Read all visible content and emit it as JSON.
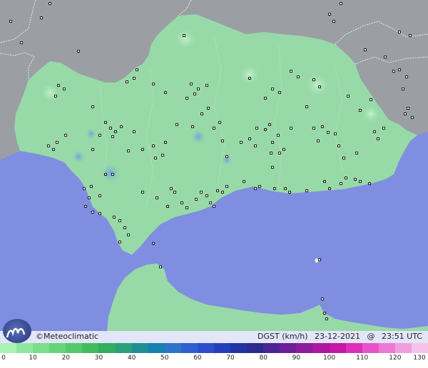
{
  "brand": {
    "logo": "Meteoclimatic logo",
    "text": "©Meteoclimatic"
  },
  "info": {
    "variable": "DGST (km/h)",
    "date": "23-12-2021",
    "at": "@",
    "time": "23:51 UTC"
  },
  "legend": {
    "ticks": [
      "0",
      "10",
      "20",
      "30",
      "40",
      "50",
      "60",
      "70",
      "80",
      "90",
      "100",
      "110",
      "120",
      "130"
    ],
    "colors": [
      "#a9f2b4",
      "#8fe79f",
      "#7ade8a",
      "#66d57a",
      "#53c96b",
      "#41bb5e",
      "#32ad61",
      "#2aa07a",
      "#1f8f95",
      "#1781b0",
      "#2f74c7",
      "#2f5fd0",
      "#2b4dcc",
      "#253fba",
      "#2234a4",
      "#2a2a90",
      "#4b2493",
      "#6c1f97",
      "#8d1b9b",
      "#ad179f",
      "#c816a6",
      "#db2fb8",
      "#e653c8",
      "#ec78d5",
      "#f19ee0",
      "#f6c2ea"
    ]
  },
  "stations": [
    [
      15,
      30
    ],
    [
      70,
      5
    ],
    [
      58,
      25
    ],
    [
      30,
      60
    ],
    [
      110,
      72
    ],
    [
      192,
      98
    ],
    [
      188,
      110
    ],
    [
      178,
      115
    ],
    [
      215,
      118
    ],
    [
      232,
      130
    ],
    [
      268,
      118
    ],
    [
      278,
      125
    ],
    [
      290,
      120
    ],
    [
      273,
      132
    ],
    [
      262,
      138
    ],
    [
      258,
      50
    ],
    [
      350,
      110
    ],
    [
      372,
      138
    ],
    [
      382,
      125
    ],
    [
      392,
      130
    ],
    [
      408,
      100
    ],
    [
      418,
      108
    ],
    [
      440,
      112
    ],
    [
      448,
      122
    ],
    [
      488,
      135
    ],
    [
      505,
      155
    ],
    [
      520,
      140
    ],
    [
      552,
      100
    ],
    [
      560,
      98
    ],
    [
      570,
      108
    ],
    [
      565,
      125
    ],
    [
      572,
      152
    ],
    [
      568,
      160
    ],
    [
      578,
      165
    ],
    [
      512,
      70
    ],
    [
      540,
      80
    ],
    [
      575,
      50
    ],
    [
      560,
      45
    ],
    [
      468,
      30
    ],
    [
      462,
      20
    ],
    [
      478,
      5
    ],
    [
      82,
      120
    ],
    [
      90,
      125
    ],
    [
      78,
      135
    ],
    [
      130,
      150
    ],
    [
      148,
      172
    ],
    [
      155,
      180
    ],
    [
      162,
      185
    ],
    [
      140,
      190
    ],
    [
      158,
      192
    ],
    [
      170,
      178
    ],
    [
      188,
      185
    ],
    [
      130,
      210
    ],
    [
      92,
      190
    ],
    [
      80,
      200
    ],
    [
      75,
      210
    ],
    [
      68,
      205
    ],
    [
      180,
      212
    ],
    [
      200,
      210
    ],
    [
      215,
      205
    ],
    [
      218,
      222
    ],
    [
      228,
      218
    ],
    [
      232,
      200
    ],
    [
      248,
      175
    ],
    [
      270,
      178
    ],
    [
      283,
      160
    ],
    [
      292,
      152
    ],
    [
      300,
      180
    ],
    [
      308,
      172
    ],
    [
      312,
      198
    ],
    [
      318,
      220
    ],
    [
      338,
      200
    ],
    [
      350,
      195
    ],
    [
      358,
      205
    ],
    [
      360,
      180
    ],
    [
      372,
      182
    ],
    [
      378,
      175
    ],
    [
      382,
      200
    ],
    [
      390,
      190
    ],
    [
      398,
      210
    ],
    [
      380,
      215
    ],
    [
      392,
      215
    ],
    [
      382,
      235
    ],
    [
      408,
      180
    ],
    [
      430,
      150
    ],
    [
      440,
      180
    ],
    [
      446,
      198
    ],
    [
      452,
      178
    ],
    [
      460,
      186
    ],
    [
      470,
      188
    ],
    [
      475,
      205
    ],
    [
      482,
      222
    ],
    [
      500,
      215
    ],
    [
      525,
      185
    ],
    [
      530,
      195
    ],
    [
      538,
      180
    ],
    [
      455,
      255
    ],
    [
      462,
      265
    ],
    [
      478,
      258
    ],
    [
      485,
      250
    ],
    [
      498,
      252
    ],
    [
      505,
      255
    ],
    [
      518,
      258
    ],
    [
      118,
      265
    ],
    [
      128,
      262
    ],
    [
      125,
      278
    ],
    [
      120,
      290
    ],
    [
      130,
      298
    ],
    [
      140,
      300
    ],
    [
      160,
      305
    ],
    [
      168,
      310
    ],
    [
      175,
      320
    ],
    [
      180,
      330
    ],
    [
      168,
      340
    ],
    [
      200,
      270
    ],
    [
      220,
      278
    ],
    [
      235,
      290
    ],
    [
      240,
      265
    ],
    [
      245,
      270
    ],
    [
      255,
      285
    ],
    [
      262,
      292
    ],
    [
      275,
      280
    ],
    [
      282,
      270
    ],
    [
      290,
      275
    ],
    [
      295,
      285
    ],
    [
      300,
      290
    ],
    [
      305,
      268
    ],
    [
      312,
      270
    ],
    [
      318,
      262
    ],
    [
      342,
      255
    ],
    [
      358,
      265
    ],
    [
      364,
      262
    ],
    [
      385,
      265
    ],
    [
      400,
      265
    ],
    [
      406,
      270
    ],
    [
      430,
      268
    ],
    [
      148,
      245
    ],
    [
      158,
      245
    ],
    [
      140,
      275
    ],
    [
      215,
      342
    ],
    [
      225,
      375
    ],
    [
      448,
      365
    ],
    [
      452,
      420
    ],
    [
      455,
      440
    ],
    [
      458,
      448
    ]
  ]
}
